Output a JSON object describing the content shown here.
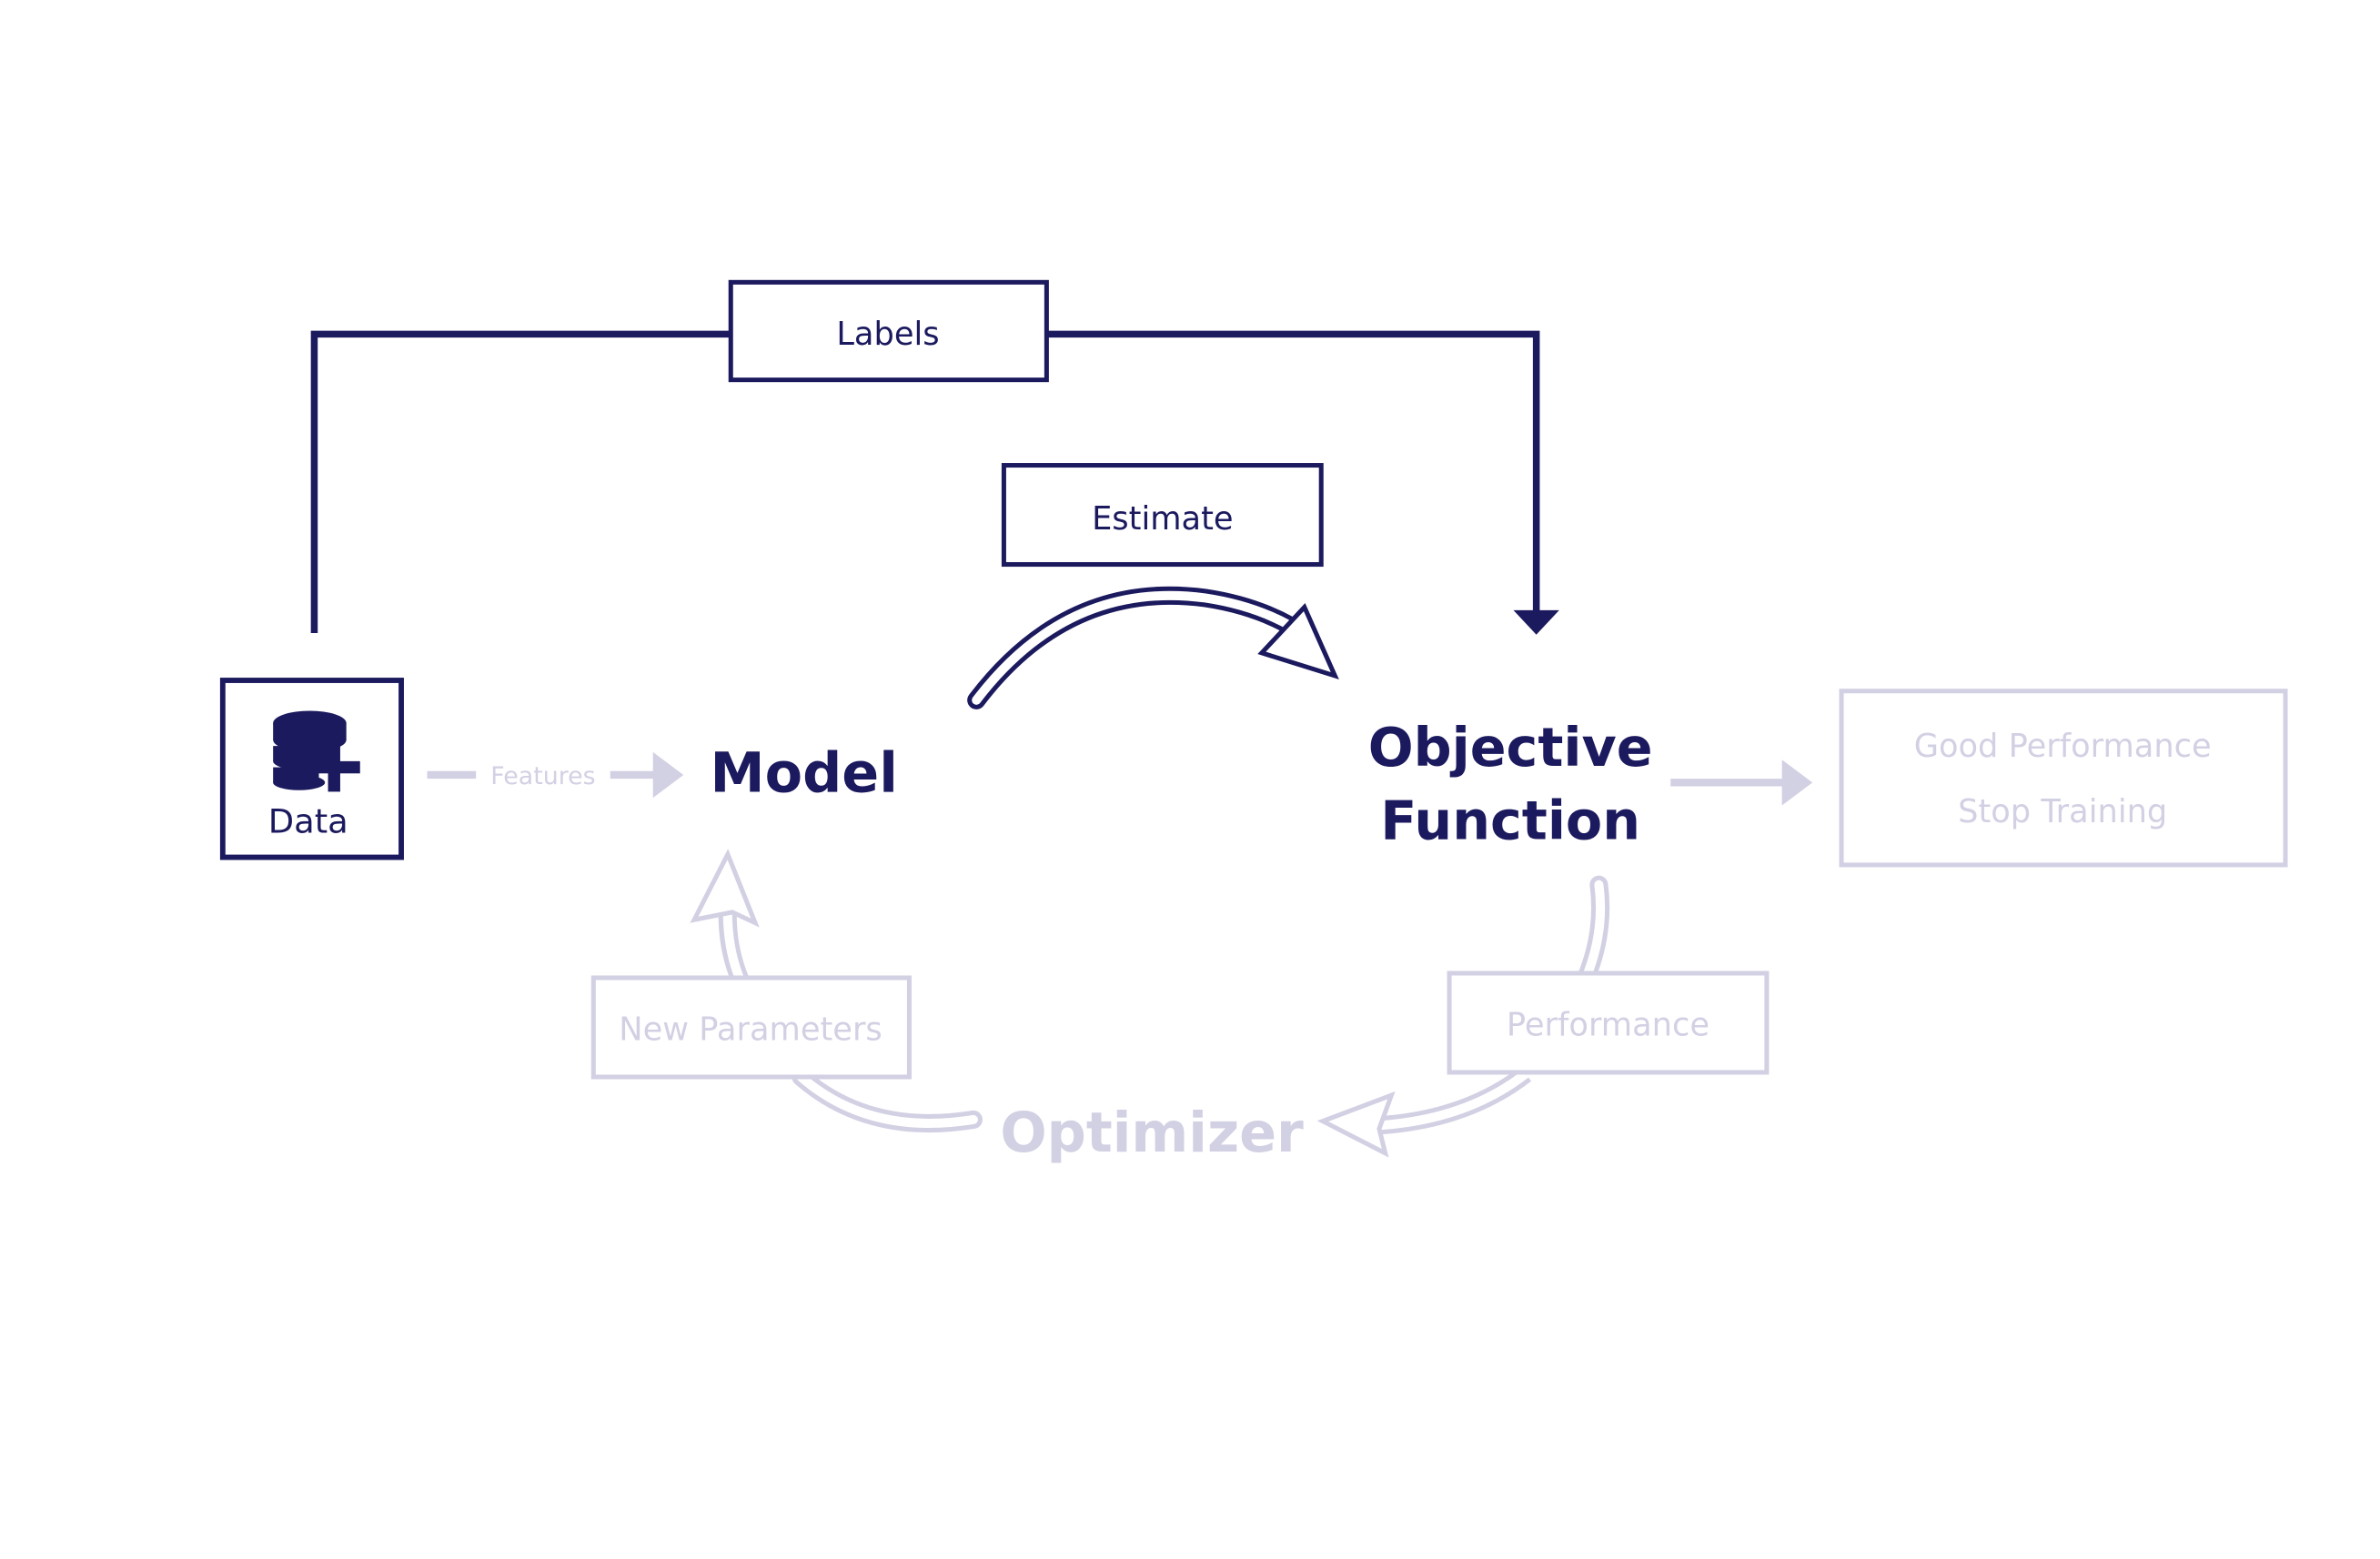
{
  "colors": {
    "active": "#1c1a5e",
    "inactive": "#d2d0e3",
    "background": "#ffffff"
  },
  "nodes": {
    "data": {
      "label": "Data",
      "icon": "database-plus-icon"
    },
    "labels": {
      "label": "Labels"
    },
    "estimate": {
      "label": "Estimate"
    },
    "model": {
      "label": "Model"
    },
    "objective": {
      "line1": "Objective",
      "line2": "Function"
    },
    "features": {
      "label": "Features"
    },
    "good_performance": {
      "line1": "Good Performance",
      "line2": "Stop Training"
    },
    "performance": {
      "label": "Performance"
    },
    "new_parameters": {
      "label": "New Parameters"
    },
    "optimizer": {
      "label": "Optimizer"
    }
  }
}
